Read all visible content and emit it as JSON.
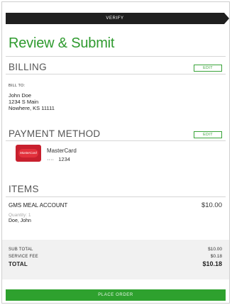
{
  "progress": {
    "step_label": "VERIFY"
  },
  "page_title": "Review & Submit",
  "billing": {
    "heading": "BILLING",
    "edit_label": "EDIT",
    "bill_to_label": "BILL TO:",
    "name": "John Doe",
    "street": "1234 S Main",
    "city_state_zip": "Nowhere, KS 11111"
  },
  "payment": {
    "heading": "PAYMENT METHOD",
    "edit_label": "EDIT",
    "card_logo_text": "MasterCard",
    "card_brand": "MasterCard",
    "card_masked": "····",
    "card_last4": "1234",
    "brand_color": "#c8202e"
  },
  "items": {
    "heading": "ITEMS",
    "list": [
      {
        "name": "GMS MEAL ACCOUNT",
        "price": "$10.00",
        "quantity": "Quantity: 1",
        "recipient": "Doe, John"
      }
    ]
  },
  "totals": {
    "subtotal_label": "SUB TOTAL",
    "subtotal_value": "$10.00",
    "service_fee_label": "SERVICE FEE",
    "service_fee_value": "$0.18",
    "total_label": "TOTAL",
    "total_value": "$10.18"
  },
  "place_order_label": "PLACE ORDER",
  "colors": {
    "accent": "#2e9a2e",
    "dark_bar": "#1f1f1f",
    "totals_bg": "#f1f1f1"
  }
}
